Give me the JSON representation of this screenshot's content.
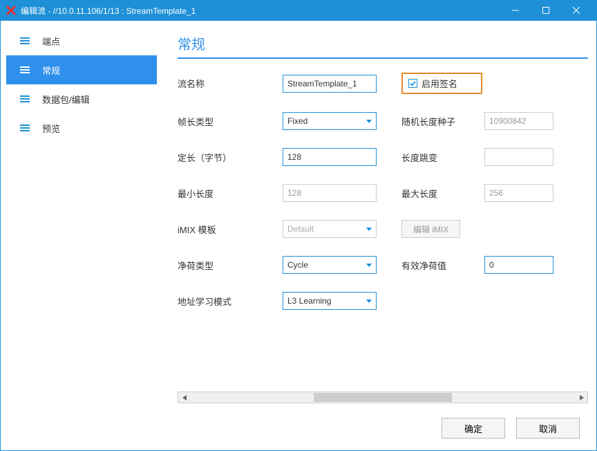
{
  "window": {
    "title": "编辑流 - //10.0.11.106/1/13 : StreamTemplate_1"
  },
  "sidebar": {
    "items": [
      {
        "label": "端点"
      },
      {
        "label": "常规"
      },
      {
        "label": "数据包/编辑"
      },
      {
        "label": "预览"
      }
    ],
    "activeIndex": 1
  },
  "content": {
    "header": "常规",
    "labels": {
      "streamName": "流名称",
      "frameLenType": "帧长类型",
      "fixedLen": "定长（字节）",
      "minLen": "最小长度",
      "imixTemplate": "iMIX 模板",
      "payloadType": "净荷类型",
      "addrLearnMode": "地址学习模式",
      "enableSig": "启用签名",
      "randSeed": "随机长度种子",
      "lenJump": "长度跳变",
      "maxLen": "最大长度",
      "editImix": "编辑 iMIX",
      "payloadValue": "有效净荷值"
    },
    "values": {
      "streamName": "StreamTemplate_1",
      "frameLenType": "Fixed",
      "fixedLen": "128",
      "minLen": "128",
      "imixTemplate": "Default",
      "payloadType": "Cycle",
      "addrLearnMode": "L3 Learning",
      "randSeed": "10900842",
      "maxLen": "256",
      "payloadValue": "0",
      "enableSigChecked": true
    }
  },
  "footer": {
    "ok": "确定",
    "cancel": "取消"
  }
}
